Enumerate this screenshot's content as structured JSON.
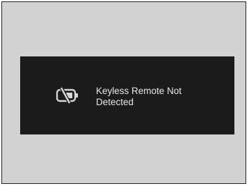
{
  "display": {
    "icon": "keyless-remote-battery-slash-icon",
    "message_line1": "Keyless Remote Not",
    "message_line2": "Detected"
  },
  "colors": {
    "frame_background": "#d2d2d2",
    "panel_background": "#1b1b1b",
    "text": "#e8e8e8"
  }
}
